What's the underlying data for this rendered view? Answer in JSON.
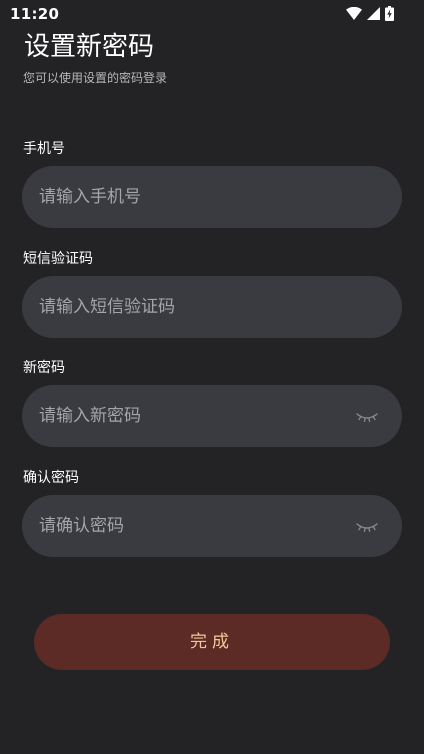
{
  "status_bar": {
    "time": "11:20",
    "icons": [
      "wifi-icon",
      "signal-icon",
      "battery-charging-icon"
    ]
  },
  "header": {
    "title": "设置新密码",
    "subtitle": "您可以使用设置的密码登录"
  },
  "form": {
    "phone": {
      "label": "手机号",
      "placeholder": "请输入手机号",
      "value": ""
    },
    "sms_code": {
      "label": "短信验证码",
      "placeholder": "请输入短信验证码",
      "value": ""
    },
    "new_password": {
      "label": "新密码",
      "placeholder": "请输入新密码",
      "value": "",
      "toggle_icon": "eye-closed-icon"
    },
    "confirm_password": {
      "label": "确认密码",
      "placeholder": "请确认密码",
      "value": "",
      "toggle_icon": "eye-closed-icon"
    },
    "submit_label": "完成"
  },
  "colors": {
    "background": "#232326",
    "field_background": "#393b40",
    "placeholder": "#a4a5aa",
    "button_background": "#5c2b26",
    "button_text": "#f3c79b"
  }
}
